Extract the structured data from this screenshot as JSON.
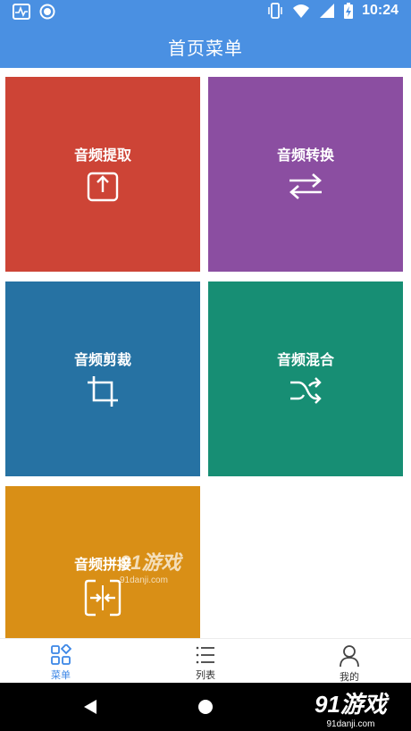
{
  "status": {
    "time": "10:24"
  },
  "header": {
    "title": "首页菜单"
  },
  "tiles": [
    {
      "label": "音频提取",
      "color": "#cd4436",
      "icon": "upload-box-icon"
    },
    {
      "label": "音频转换",
      "color": "#8b4ea1",
      "icon": "swap-arrows-icon"
    },
    {
      "label": "音频剪裁",
      "color": "#2672a3",
      "icon": "crop-icon"
    },
    {
      "label": "音频混合",
      "color": "#178e74",
      "icon": "shuffle-icon"
    },
    {
      "label": "音频拼接",
      "color": "#d98f16",
      "icon": "merge-box-icon"
    }
  ],
  "bottom_nav": [
    {
      "label": "菜单",
      "icon": "grid-icon",
      "active": true
    },
    {
      "label": "列表",
      "icon": "list-icon",
      "active": false
    },
    {
      "label": "我的",
      "icon": "person-icon",
      "active": false
    }
  ],
  "watermark": {
    "brand": "91游戏",
    "site": "91danji.com"
  },
  "colors": {
    "primary": "#4a90e2",
    "active_tab": "#3b86e6"
  }
}
